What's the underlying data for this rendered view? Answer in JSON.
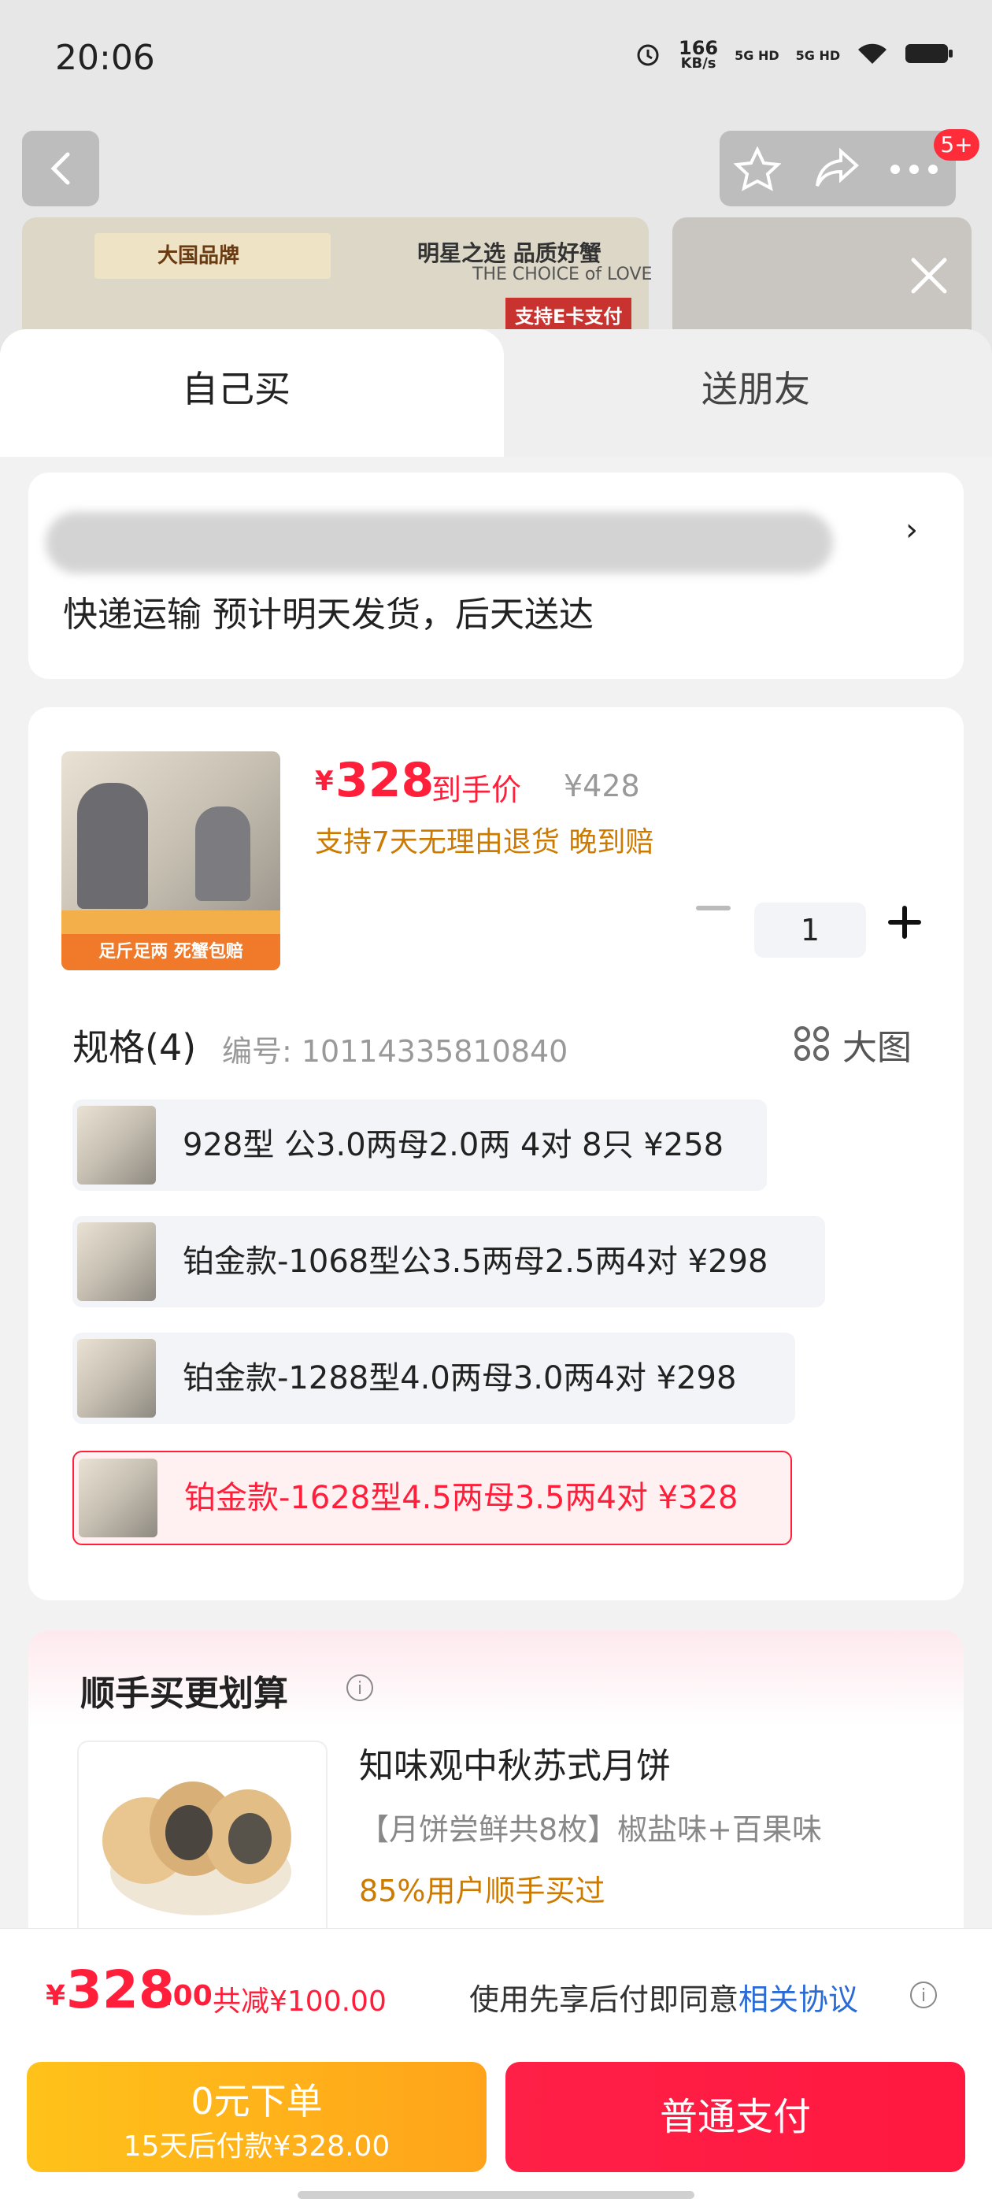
{
  "status_bar": {
    "time": "20:06",
    "net_speed": "166",
    "net_unit": "KB/s",
    "sig1": "5G HD",
    "sig2": "5G HD"
  },
  "header": {
    "more_badge": "5+"
  },
  "banner": {
    "tagline": "明星之选 品质好蟹",
    "tagline_en": "THE CHOICE of LOVE",
    "pay_tag": "支持E卡支付",
    "brand": "大国品牌"
  },
  "tabs": [
    {
      "label": "自己买"
    },
    {
      "label": "送朋友"
    }
  ],
  "address": {
    "shipping_text": "快递运输 预计明天发货，后天送达",
    "chevron": "›"
  },
  "product": {
    "price_currency": "¥",
    "price": "328",
    "price_tag": "到手价",
    "original_price": "¥428",
    "promises": "支持7天无理由退货 晚到赔",
    "thumb_strip": "足斤足两 死蟹包赔",
    "quantity": "1"
  },
  "specs": {
    "title": "规格(4)",
    "code": "编号: 10114335810840",
    "big_image_label": "大图",
    "options": [
      {
        "label": "928型 公3.0两母2.0两 4对 8只  ¥258"
      },
      {
        "label": "铂金款-1068型公3.5两母2.5两4对  ¥298"
      },
      {
        "label": "铂金款-1288型4.0两母3.0两4对  ¥298"
      },
      {
        "label": "铂金款-1628型4.5两母3.5两4对  ¥328"
      }
    ],
    "selected_index": 3
  },
  "addon": {
    "title": "顺手买更划算",
    "info_glyph": "i",
    "name": "知味观中秋苏式月饼",
    "desc": "【月饼尝鲜共8枚】椒盐味+百果味",
    "stat": "85%用户顺手买过"
  },
  "footer": {
    "currency": "¥",
    "total": "328",
    "total_decimal": ".00",
    "saving": "共减¥100.00",
    "agreement_prefix": "使用先享后付即同意",
    "agreement_link": "相关协议",
    "btn_later_line1": "0元下单",
    "btn_later_line2": "15天后付款¥328.00",
    "btn_pay": "普通支付"
  },
  "colors": {
    "accent_red": "#ff1f3a",
    "orange_text": "#cc7a00",
    "link_blue": "#2a6bd8",
    "later_btn": "#ffb01a"
  }
}
